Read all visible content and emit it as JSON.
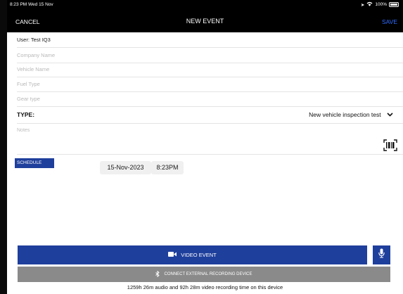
{
  "status_bar": {
    "time_date": "8:23 PM  Wed 15 Nov",
    "battery": "100%"
  },
  "navbar": {
    "cancel": "CANCEL",
    "title": "NEW EVENT",
    "save": "SAVE",
    "save_color": "#2f6bff"
  },
  "form": {
    "user": "User: Test IQ3",
    "company_placeholder": "Company Name",
    "vehicle_placeholder": "Vehicle Name",
    "fuel_placeholder": "Fuel Type",
    "gear_placeholder": "Gear type",
    "type_label": "TYPE:",
    "type_value": "New vehicle inspection test",
    "notes_placeholder": "Notes"
  },
  "schedule": {
    "label": "SCHEDULE",
    "date": "15-Nov-2023",
    "time": "8:23PM"
  },
  "actions": {
    "video_event": "VIDEO EVENT",
    "connect_external": "CONNECT EXTERNAL RECORDING DEVICE",
    "recording_time": "1259h 26m audio and 92h 28m video recording time on this device",
    "primary_color": "#1f3f9c",
    "secondary_color": "#8a8a8a"
  }
}
